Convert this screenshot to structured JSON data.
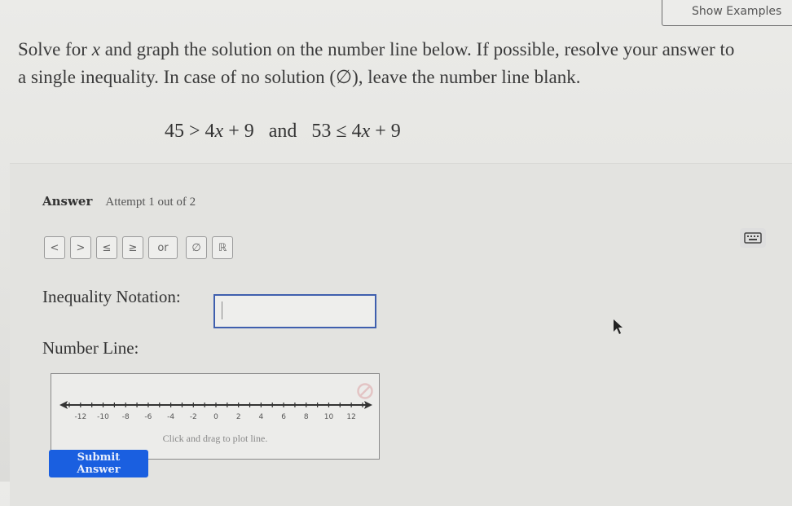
{
  "header": {
    "show_examples_label": "Show Examples"
  },
  "prompt": {
    "part1": "Solve for ",
    "variable": "x",
    "part2": " and graph the solution on the number line below. If possible, resolve your answer to",
    "line2": "a single inequality. In case of no solution (∅), leave the number line blank."
  },
  "problem": {
    "left": {
      "lhs": "45",
      "op": ">",
      "coef": "4",
      "var": "x",
      "rest": "+ 9"
    },
    "joiner": "and",
    "right": {
      "lhs": "53",
      "op": "≤",
      "coef": "4",
      "var": "x",
      "rest": "+ 9"
    }
  },
  "answer": {
    "label": "Answer",
    "attempt": "Attempt 1 out of 2",
    "symbol_buttons": [
      "<",
      ">",
      "≤",
      "≥",
      "or",
      "∅",
      "ℝ"
    ]
  },
  "inequality_field": {
    "label": "Inequality Notation:",
    "value": ""
  },
  "number_line": {
    "label": "Number Line:",
    "min": -13,
    "max": 13,
    "tick_labels": [
      "-12",
      "-10",
      "-8",
      "-6",
      "-4",
      "-2",
      "0",
      "2",
      "4",
      "6",
      "8",
      "10",
      "12"
    ],
    "hint": "Click and drag to plot line."
  },
  "submit_label": "Submit Answer"
}
